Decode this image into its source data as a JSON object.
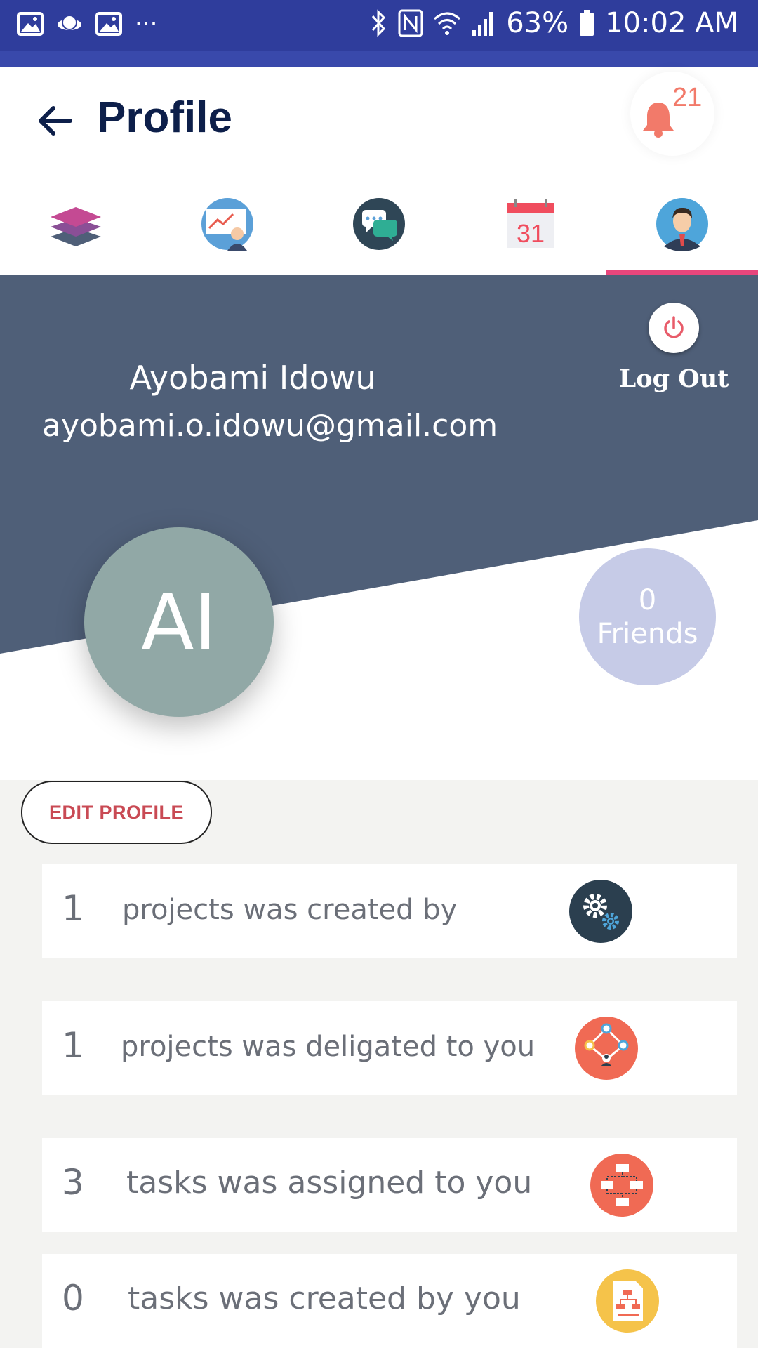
{
  "status_bar": {
    "battery": "63%",
    "time": "10:02 AM",
    "more": "···"
  },
  "header": {
    "title": "Profile",
    "notification_count": "21"
  },
  "tabs": [
    {
      "name": "layers-icon"
    },
    {
      "name": "presentation-icon"
    },
    {
      "name": "chat-icon"
    },
    {
      "name": "calendar-icon",
      "text": "31"
    },
    {
      "name": "user-icon",
      "active": true
    }
  ],
  "profile": {
    "name": "Ayobami Idowu",
    "email": "ayobami.o.idowu@gmail.com",
    "initials": "AI",
    "logout_label": "Log Out",
    "friends_count": "0",
    "friends_label": "Friends"
  },
  "edit_profile_label": "EDIT PROFILE",
  "stats": [
    {
      "count": "1",
      "label": "projects was created by",
      "icon": "gears-icon"
    },
    {
      "count": "1",
      "label": "projects was deligated to you",
      "icon": "network-icon"
    },
    {
      "count": "3",
      "label": "tasks was assigned to you",
      "icon": "workflow-icon"
    },
    {
      "count": "0",
      "label": "tasks was created by you",
      "icon": "document-icon"
    }
  ],
  "colors": {
    "status_bar": "#2f3d9c",
    "hero": "#4f5f78",
    "accent": "#e8467c",
    "avatar": "#91a8a6",
    "friends": "#c6cbe7"
  }
}
